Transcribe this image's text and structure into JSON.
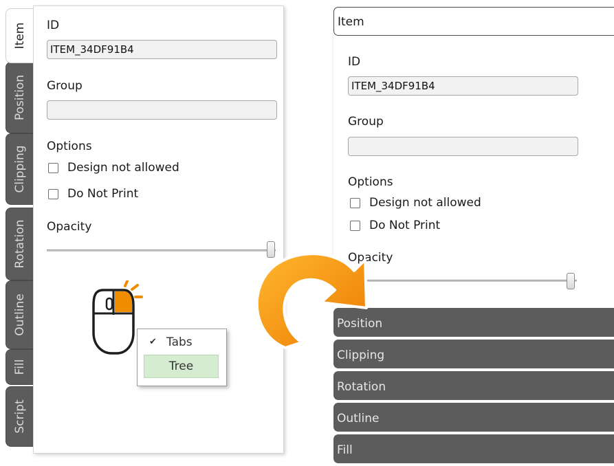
{
  "left": {
    "tabs": [
      {
        "label": "Item",
        "active": true
      },
      {
        "label": "Position"
      },
      {
        "label": "Clipping"
      },
      {
        "label": "Rotation"
      },
      {
        "label": "Outline"
      },
      {
        "label": "Fill"
      },
      {
        "label": "Script"
      }
    ],
    "id_label": "ID",
    "id_value": "ITEM_34DF91B4",
    "group_label": "Group",
    "group_value": "",
    "options_label": "Options",
    "opt_design": "Design not allowed",
    "opt_print": "Do Not Print",
    "opacity_label": "Opacity",
    "opacity_value": 1.0
  },
  "context_menu": {
    "items": [
      {
        "label": "Tabs",
        "checked": true
      },
      {
        "label": "Tree",
        "highlighted": true
      }
    ],
    "check_glyph": "✔"
  },
  "right": {
    "header": "Item",
    "id_label": "ID",
    "id_value": "ITEM_34DF91B4",
    "group_label": "Group",
    "group_value": "",
    "options_label": "Options",
    "opt_design": "Design not allowed",
    "opt_print": "Do Not Print",
    "opacity_label": "Opacity",
    "opacity_value": 1.0,
    "sections": [
      "Position",
      "Clipping",
      "Rotation",
      "Outline",
      "Fill"
    ]
  },
  "colors": {
    "tab_dark": "#5c5c5c",
    "arrow_orange": "#f08c00",
    "menu_highlight": "#d6ecd0",
    "mouse_button": "#f08c00"
  },
  "icons": [
    "mouse-icon",
    "right-click-indicator-icon",
    "curved-arrow-icon",
    "checkmark-icon",
    "checkbox-icon"
  ]
}
